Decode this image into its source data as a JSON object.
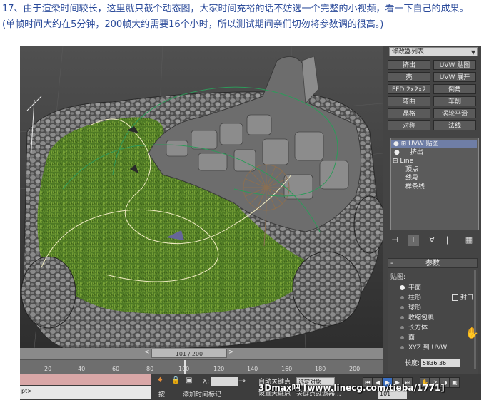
{
  "caption": {
    "line1": "17、由于渲染时间较长，这里就只截个动态图，大家时间充裕的话不妨选一个完整的小视频，看一下自己的成果。",
    "line2": "(单帧时间大约在5分钟，200帧大约需要16个小时，所以测试期间亲们切勿将参数调的很高。)"
  },
  "command_panel": {
    "modifier_list": "修改器列表",
    "buttons": [
      "挤出",
      "UVW 贴图",
      "壳",
      "UVW 展开",
      "FFD 2x2x2",
      "倒角",
      "弯曲",
      "车削",
      "晶格",
      "涡轮平滑",
      "对称",
      "法线"
    ],
    "stack": [
      {
        "label": "UVW 贴图",
        "selected": true
      },
      {
        "label": "挤出",
        "selected": false
      },
      {
        "label": "Line",
        "selected": false
      },
      {
        "label": "顶点",
        "selected": false
      },
      {
        "label": "线段",
        "selected": false
      },
      {
        "label": "样条线",
        "selected": false
      }
    ],
    "parameters": {
      "rollout_title": "参数",
      "rollout_toggle": "-",
      "group_label": "贴图:",
      "mapping_options": [
        "平面",
        "柱形",
        "球形",
        "收缩包裹",
        "长方体",
        "面",
        "XYZ 到 UVW"
      ],
      "selected_option": "平面",
      "cap_label": "封口",
      "length_label": "长度:",
      "length_value": "5836.36"
    }
  },
  "timeline": {
    "frame_display": "101 / 200",
    "prev_arrow": "<",
    "next_arrow": ">",
    "ticks": [
      "20",
      "40",
      "60",
      "80",
      "100",
      "120",
      "140",
      "160",
      "180",
      "200"
    ],
    "current_frame": 101
  },
  "status_bar": {
    "script_text": "pt>",
    "x_label": "X:",
    "auto_key": "自动关键点",
    "set_key": "设置关键点",
    "selected_combo": "选定对象",
    "key_filter": "关键点过滤器...",
    "add_time_tag": "添加时间标记",
    "frame_field": "101",
    "key_label": "按"
  },
  "watermark": "3Dmax吧  [www.linecg.com/tieba/1771]",
  "colors": {
    "caption_text": "#2a4a9a",
    "grass": "#4f7a25",
    "rock": "#6b6b6b",
    "selected_stack": "#6f7ea6",
    "active_button": "#3a6fc2"
  }
}
